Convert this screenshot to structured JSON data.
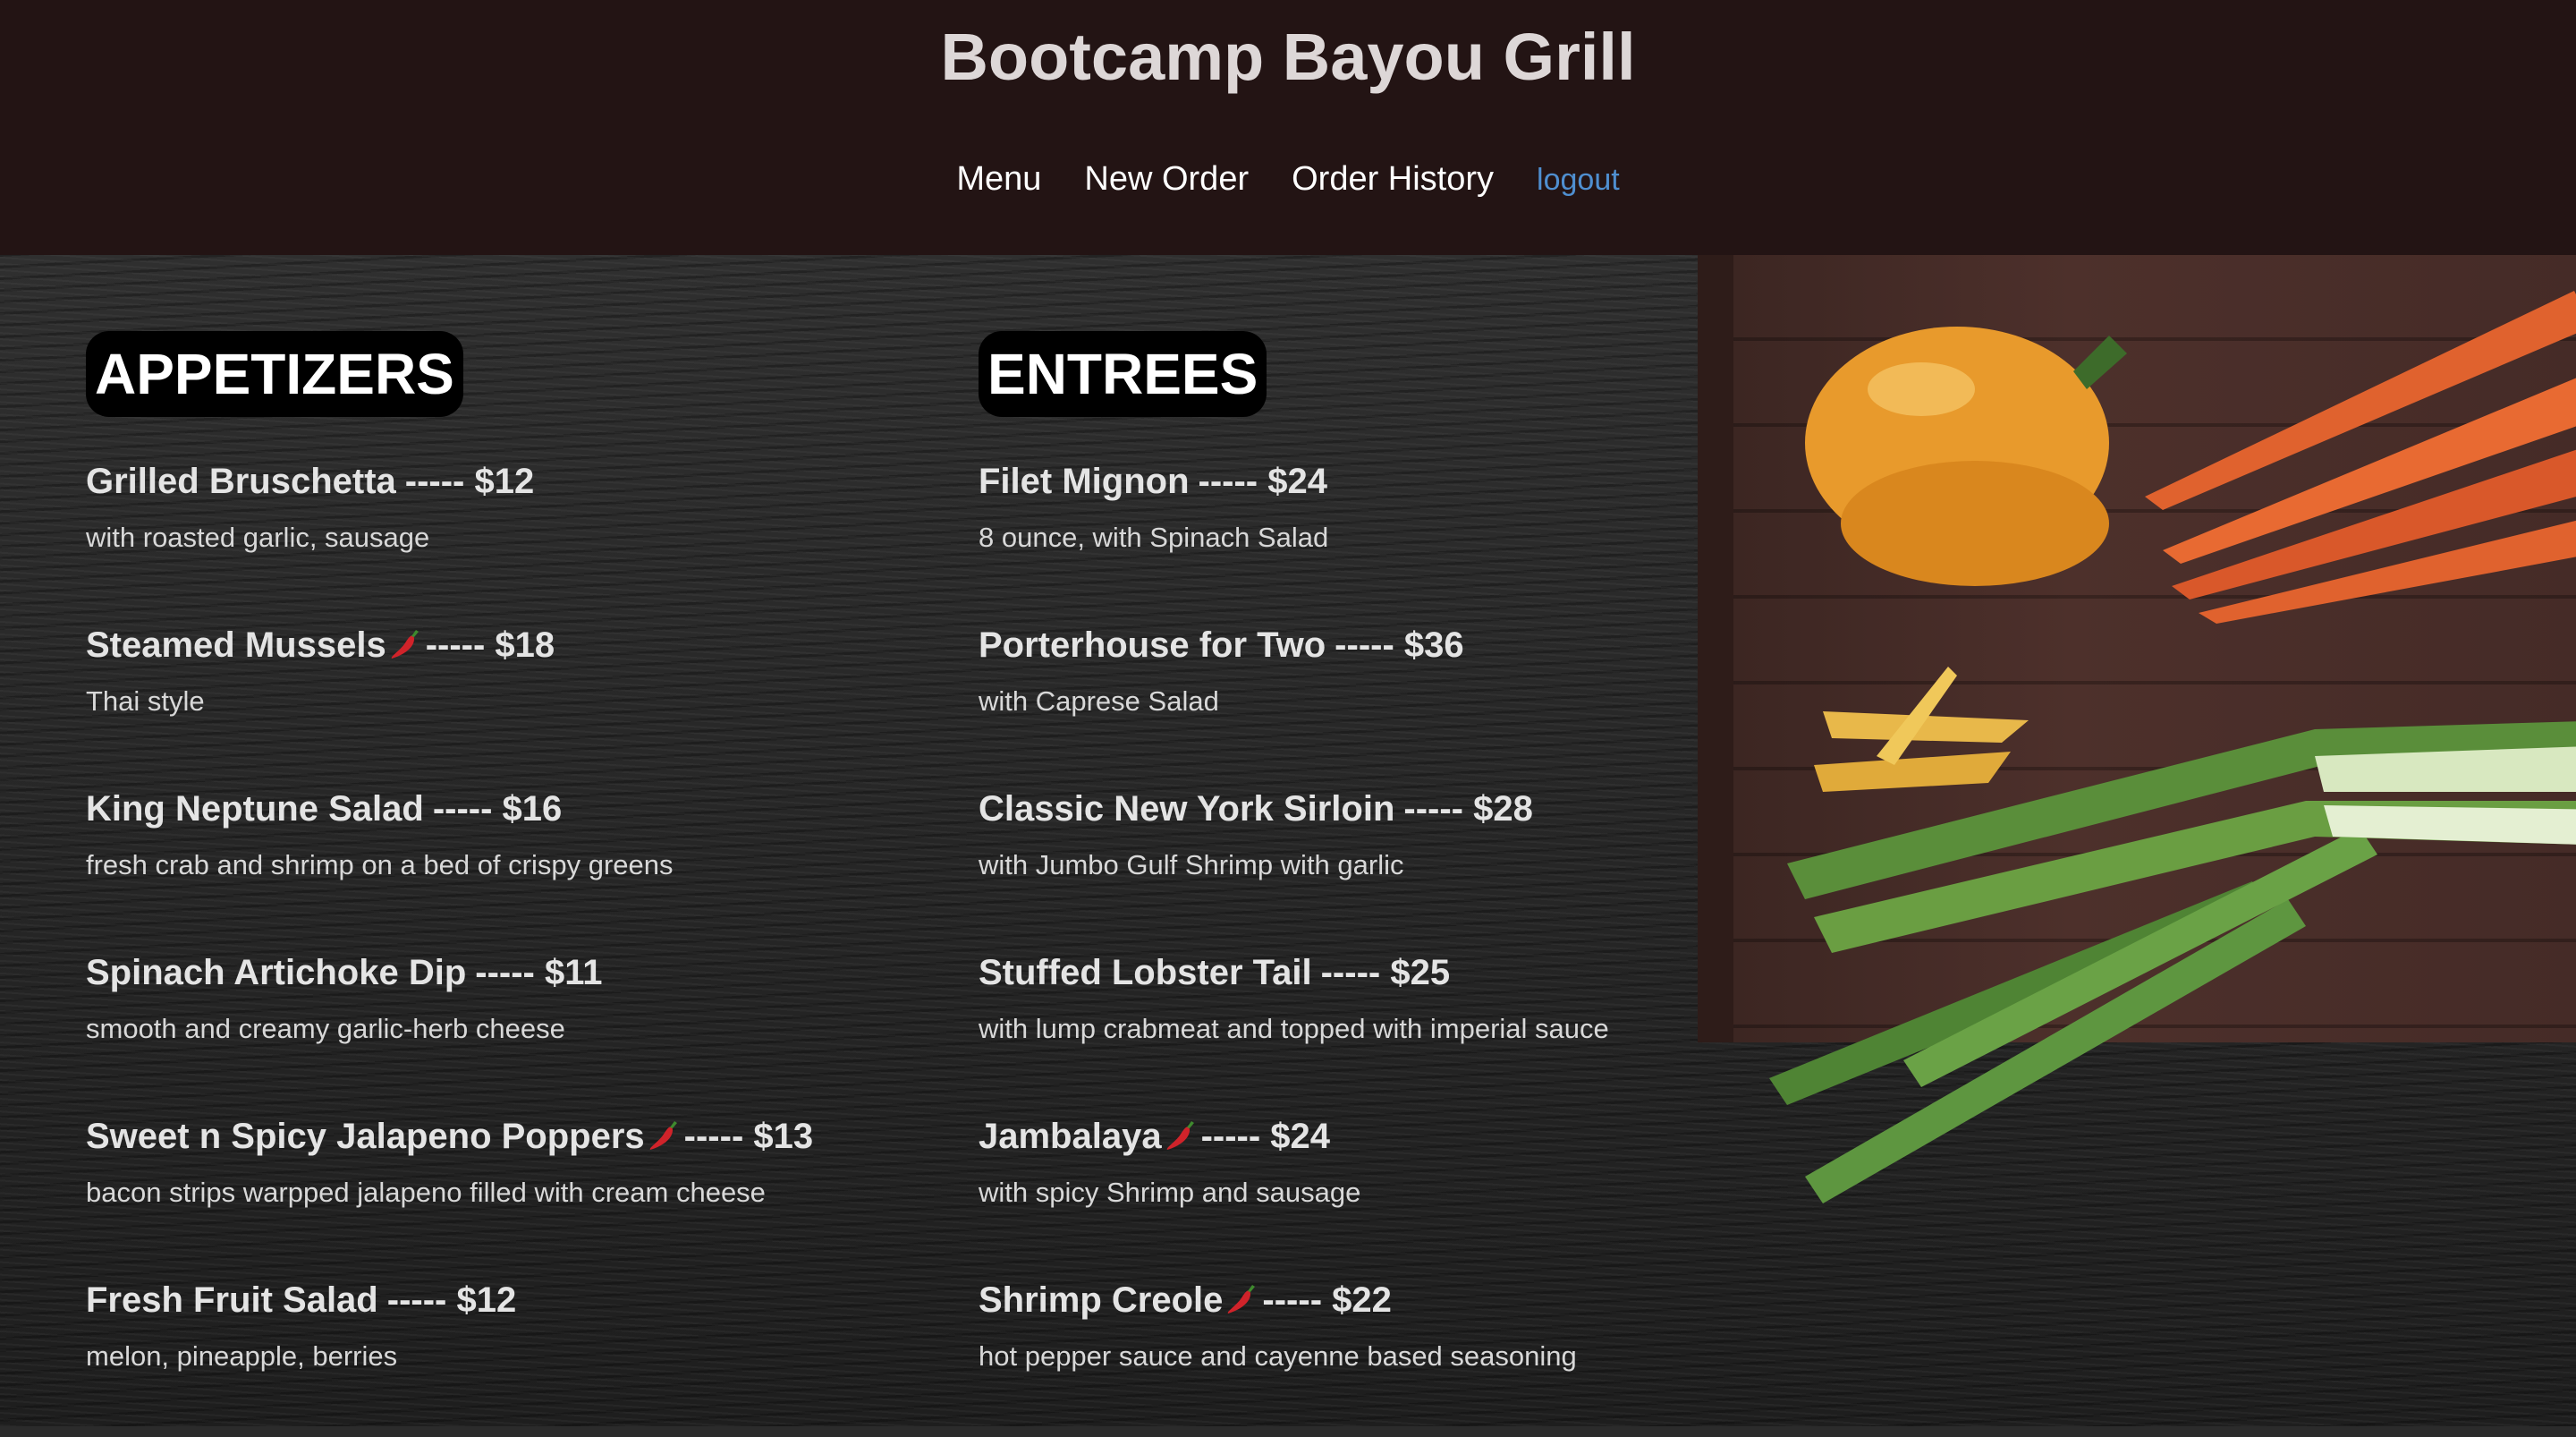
{
  "header": {
    "title": "Bootcamp Bayou Grill",
    "nav": {
      "menu": "Menu",
      "new_order": "New Order",
      "order_history": "Order History",
      "logout": "logout"
    }
  },
  "colors": {
    "header_bg": "#231414",
    "title": "#ddd7d7",
    "logout_link": "#4f8fd0",
    "section_title_bg": "#000000"
  },
  "appetizers": {
    "title": "APPETIZERS",
    "items": [
      {
        "name": "Grilled Bruschetta",
        "spicy": false,
        "price": "----- $12",
        "desc": "with roasted garlic, sausage"
      },
      {
        "name": "Steamed Mussels",
        "spicy": true,
        "price": "----- $18",
        "desc": "Thai style"
      },
      {
        "name": "King Neptune Salad",
        "spicy": false,
        "price": "----- $16",
        "desc": "fresh crab and shrimp on a bed of crispy greens"
      },
      {
        "name": "Spinach Artichoke Dip",
        "spicy": false,
        "price": "----- $11",
        "desc": "smooth and creamy garlic-herb cheese"
      },
      {
        "name": "Sweet n Spicy Jalapeno Poppers",
        "spicy": true,
        "price": "----- $13",
        "desc": "bacon strips warpped jalapeno filled with cream cheese"
      },
      {
        "name": "Fresh Fruit Salad",
        "spicy": false,
        "price": "----- $12",
        "desc": "melon, pineapple, berries"
      }
    ]
  },
  "entrees": {
    "title": "ENTREES",
    "items": [
      {
        "name": "Filet Mignon",
        "spicy": false,
        "price": "----- $24",
        "desc": "8 ounce, with Spinach Salad"
      },
      {
        "name": "Porterhouse for Two",
        "spicy": false,
        "price": "----- $36",
        "desc": "with Caprese Salad"
      },
      {
        "name": "Classic New York Sirloin",
        "spicy": false,
        "price": "----- $28",
        "desc": "with Jumbo Gulf Shrimp with garlic"
      },
      {
        "name": "Stuffed Lobster Tail",
        "spicy": false,
        "price": "----- $25",
        "desc": "with lump crabmeat and topped with imperial sauce"
      },
      {
        "name": "Jambalaya",
        "spicy": true,
        "price": "----- $24",
        "desc": "with spicy Shrimp and sausage"
      },
      {
        "name": "Shrimp Creole",
        "spicy": true,
        "price": "----- $22",
        "desc": "hot pepper sauce and cayenne based seasoning"
      }
    ]
  },
  "icons": {
    "spicy": "chili-pepper-icon"
  }
}
